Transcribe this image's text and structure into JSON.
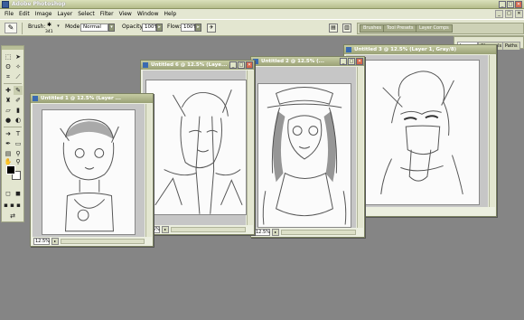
{
  "app": {
    "title": "Adobe Photoshop"
  },
  "window_buttons": {
    "minimize": "_",
    "maximize": "□",
    "close": "✕"
  },
  "menu": [
    "File",
    "Edit",
    "Image",
    "Layer",
    "Select",
    "Filter",
    "View",
    "Window",
    "Help"
  ],
  "options": {
    "brush_label": "Brush:",
    "brush_size": "341",
    "mode_label": "Mode:",
    "mode_value": "Normal",
    "opacity_label": "Opacity:",
    "opacity_value": "100%",
    "flow_label": "Flow:",
    "flow_value": "100%"
  },
  "well_tabs": [
    "Brushes",
    "Tool Presets",
    "Layer Comps"
  ],
  "panel_tabs": [
    "Layers",
    "Channels",
    "Paths"
  ],
  "documents": [
    {
      "title": "Untitled 1 @ 12.5% (Layer ...",
      "zoom": "12.5%"
    },
    {
      "title": "Untitled 6 @ 12.5% (Laye...",
      "zoom": "12.5%"
    },
    {
      "title": "Untitled 2 @ 12.5% (...",
      "zoom": "12.5%"
    },
    {
      "title": "Untitled 3 @ 12.5% (Layer 1, Gray/8)",
      "zoom": ""
    }
  ],
  "colors": {
    "workspace": "#858585",
    "chrome": "#e3e6d0",
    "title_active": "#a7b07e"
  }
}
